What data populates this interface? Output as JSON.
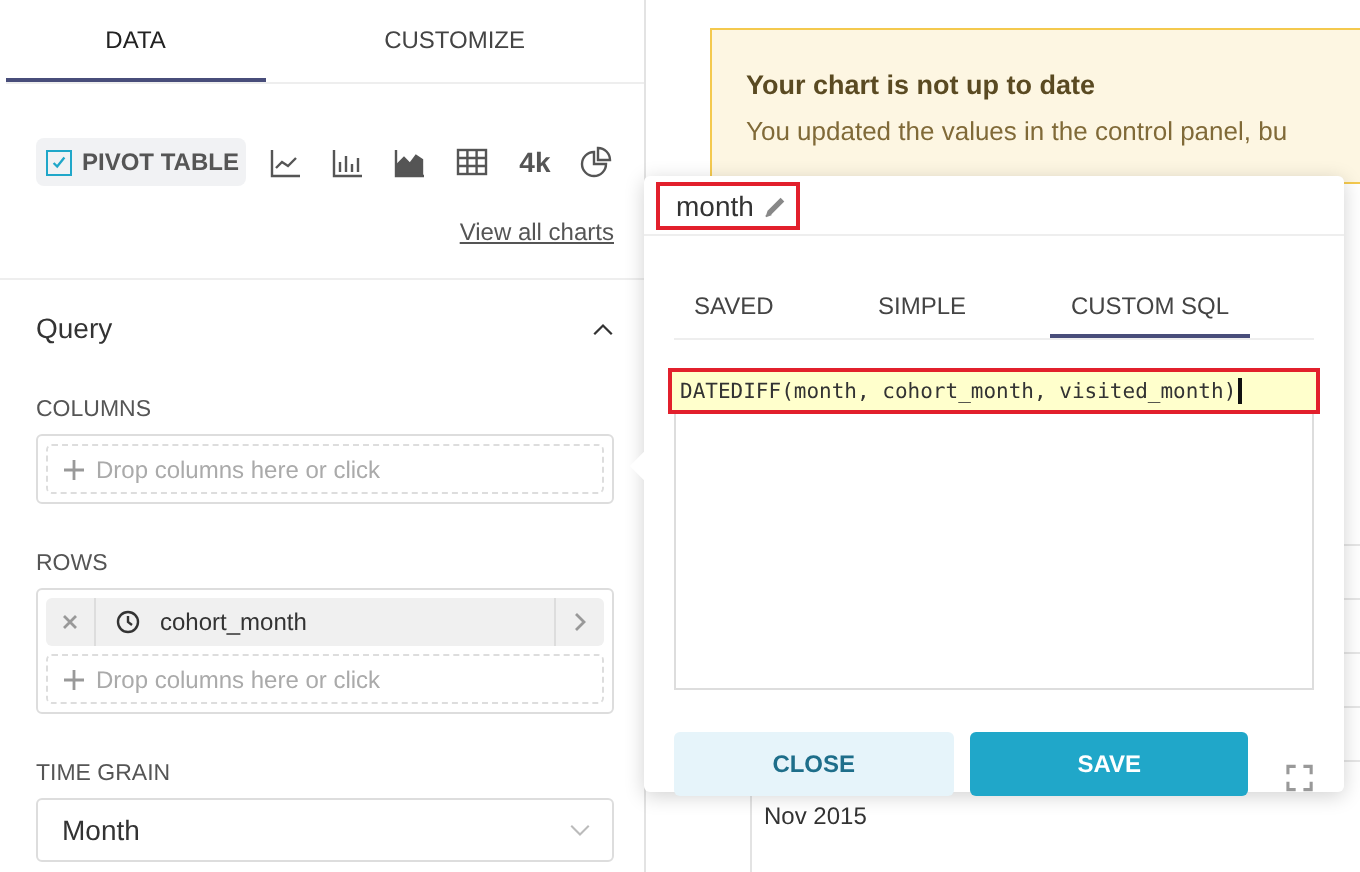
{
  "tabs": [
    {
      "label": "DATA",
      "selected": true
    },
    {
      "label": "CUSTOMIZE",
      "selected": false
    }
  ],
  "chart_types": [
    {
      "kind": "pivot",
      "label": "PIVOT TABLE",
      "selected": true
    },
    {
      "kind": "line",
      "selected": false
    },
    {
      "kind": "bar",
      "selected": false
    },
    {
      "kind": "area",
      "selected": false
    },
    {
      "kind": "table",
      "selected": false
    },
    {
      "kind": "bignumber",
      "label": "4k",
      "selected": false
    },
    {
      "kind": "pie",
      "selected": false
    }
  ],
  "view_all_link": "View all charts",
  "query": {
    "title": "Query",
    "expanded": true,
    "columns": {
      "label": "COLUMNS",
      "drop_hint": "Drop columns here or click"
    },
    "rows": {
      "label": "ROWS",
      "items": [
        {
          "name": "cohort_month"
        }
      ],
      "drop_hint": "Drop columns here or click"
    },
    "time_grain": {
      "label": "TIME GRAIN",
      "value": "Month"
    }
  },
  "alert": {
    "title": "Your chart is not up to date",
    "message": "You updated the values in the control panel, bu"
  },
  "popover": {
    "title": "month",
    "title_highlighted": true,
    "tabs": [
      {
        "label": "SAVED",
        "selected": false
      },
      {
        "label": "SIMPLE",
        "selected": false
      },
      {
        "label": "CUSTOM SQL",
        "selected": true
      }
    ],
    "sql": "DATEDIFF(month, cohort_month, visited_month)",
    "sql_highlighted": true,
    "buttons": [
      {
        "label": "CLOSE",
        "kind": "secondary"
      },
      {
        "label": "SAVE",
        "kind": "primary"
      }
    ]
  },
  "table": {
    "cells": [
      "Nov 2015"
    ]
  }
}
